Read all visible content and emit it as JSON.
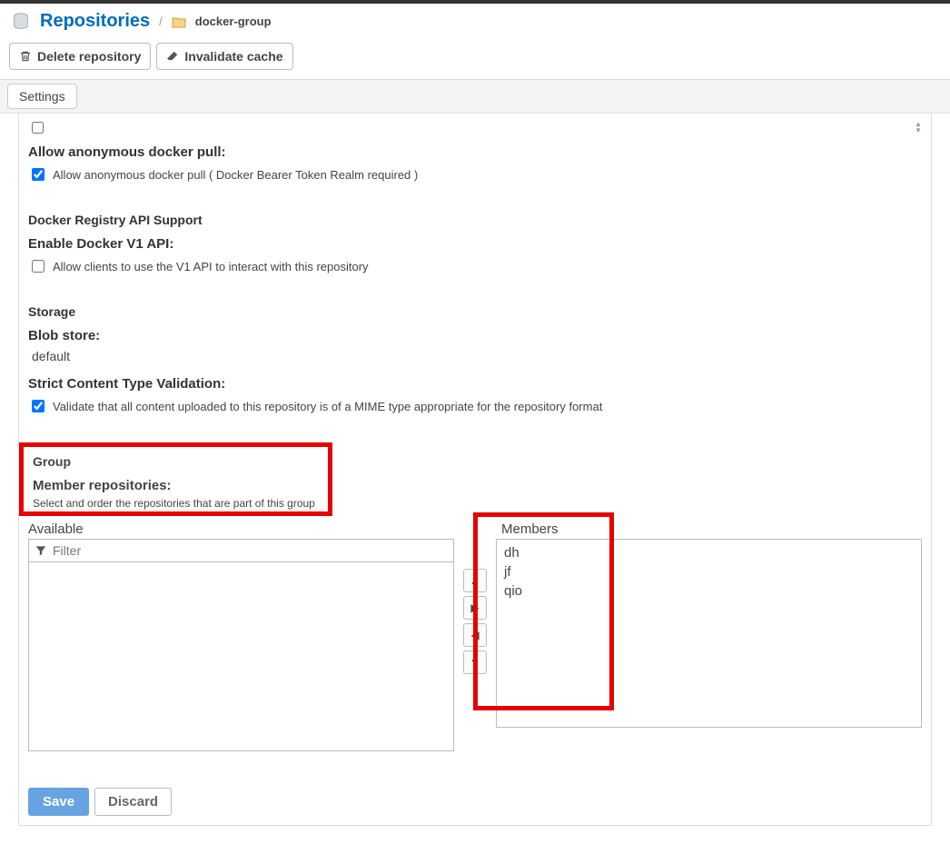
{
  "breadcrumb": {
    "title": "Repositories",
    "sep": "/",
    "repo": "docker-group"
  },
  "actions": {
    "delete": "Delete repository",
    "invalidate": "Invalidate cache"
  },
  "tab": {
    "settings": "Settings"
  },
  "anon": {
    "heading": "Allow anonymous docker pull:",
    "label": "Allow anonymous docker pull ( Docker Bearer Token Realm required )"
  },
  "api": {
    "section": "Docker Registry API Support",
    "heading": "Enable Docker V1 API:",
    "label": "Allow clients to use the V1 API to interact with this repository"
  },
  "storage": {
    "section": "Storage",
    "blob_heading": "Blob store:",
    "blob_value": "default",
    "strict_heading": "Strict Content Type Validation:",
    "strict_label": "Validate that all content uploaded to this repository is of a MIME type appropriate for the repository format"
  },
  "group": {
    "section": "Group",
    "heading": "Member repositories:",
    "help": "Select and order the repositories that are part of this group",
    "available_label": "Available",
    "filter_placeholder": "Filter",
    "members_label": "Members",
    "members": [
      "dh",
      "jf",
      "qio"
    ]
  },
  "buttons": {
    "save": "Save",
    "discard": "Discard"
  }
}
